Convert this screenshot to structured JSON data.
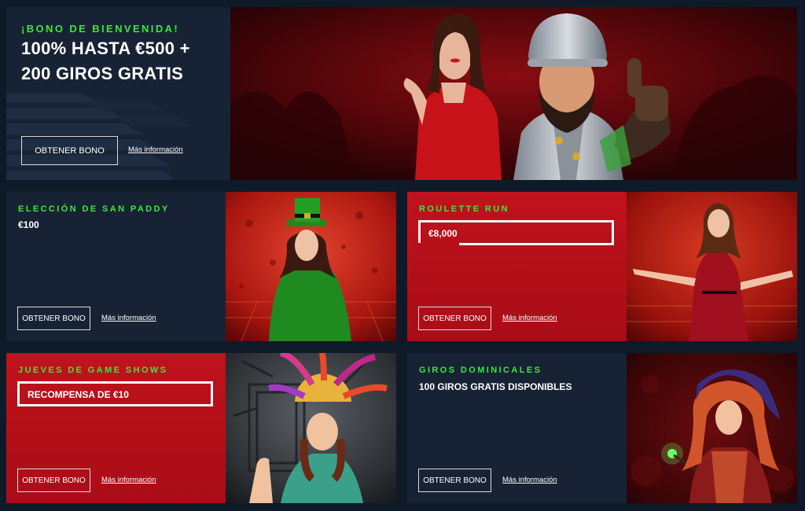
{
  "hero": {
    "eyebrow": "¡BONO DE BIENVENIDA!",
    "title_line1": "100% HASTA €500 +",
    "title_line2": "200 GIROS GRATIS",
    "button": "OBTENER BONO",
    "link": "Más información"
  },
  "promos": [
    {
      "eyebrow": "ELECCIÓN DE SAN PADDY",
      "headline": "€100",
      "button": "OBTENER BONO",
      "link": "Más información"
    },
    {
      "eyebrow": "ROULETTE RUN",
      "headline": "€8,000",
      "button": "OBTENER BONO",
      "link": "Más información"
    },
    {
      "eyebrow": "JUEVES DE GAME SHOWS",
      "headline": "RECOMPENSA DE €10",
      "button": "OBTENER BONO",
      "link": "Más información"
    },
    {
      "eyebrow": "GIROS DOMINICALES",
      "headline": "100 GIROS GRATIS DISPONIBLES",
      "button": "OBTENER BONO",
      "link": "Más información"
    }
  ],
  "colors": {
    "page_bg": "#0f1a29",
    "panel_navy": "#172335",
    "panel_red": "#b30f19",
    "accent_green": "#3ce63c"
  }
}
